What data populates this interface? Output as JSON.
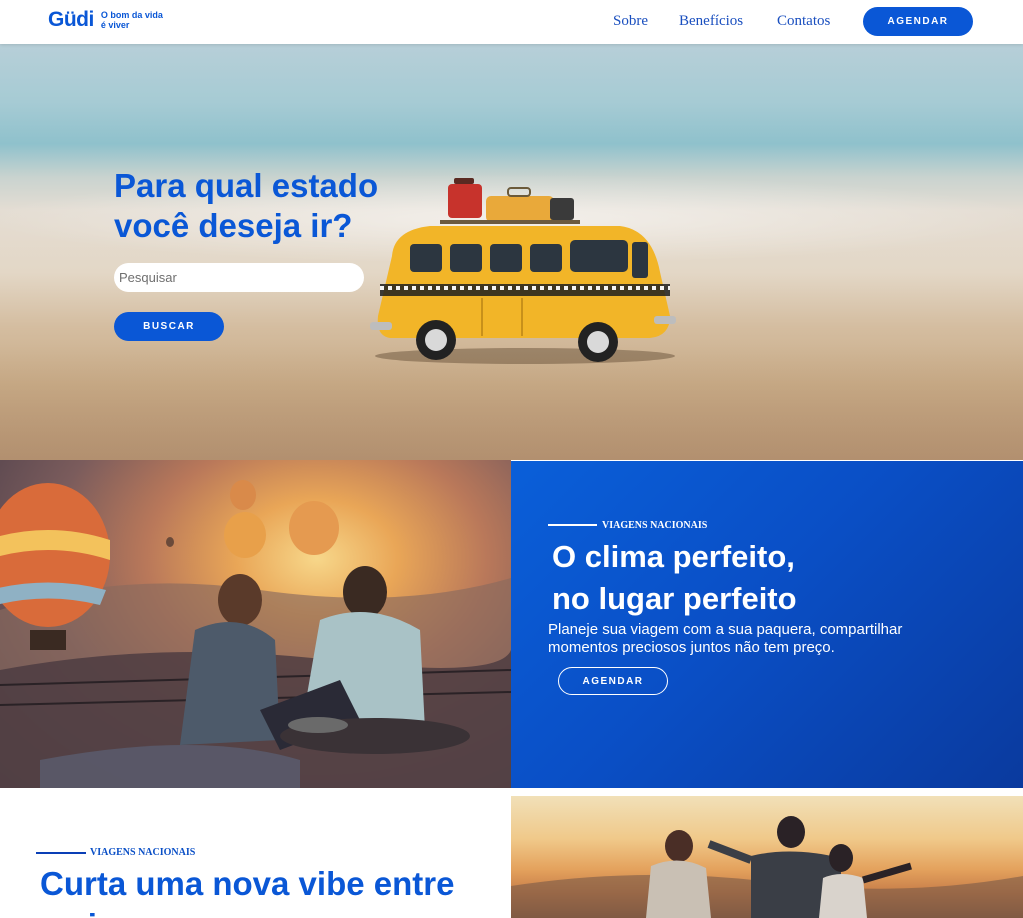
{
  "header": {
    "logo_word": "Güdi",
    "logo_tagline": "O bom da vida é viver",
    "nav": {
      "sobre": "Sobre",
      "beneficios": "Benefícios",
      "contatos": "Contatos"
    },
    "cta_label": "AGENDAR"
  },
  "hero": {
    "title": "Para qual estado você deseja ir?",
    "search_placeholder": "Pesquisar",
    "search_value": "",
    "button_label": "BUSCAR"
  },
  "feature": {
    "eyebrow": "VIAGENS NACIONAIS",
    "title_line1": "O clima perfeito,",
    "title_line2": "no lugar perfeito",
    "text": "Planeje sua viagem com a sua paquera, compartilhar momentos preciosos juntos não tem preço.",
    "button_label": "AGENDAR"
  },
  "feature2": {
    "eyebrow": "VIAGENS NACIONAIS",
    "title": "Curta uma nova vibe entre amigos"
  },
  "colors": {
    "brand_blue": "#0a57d6",
    "panel_blue": "#0a4fc6",
    "white": "#ffffff"
  }
}
